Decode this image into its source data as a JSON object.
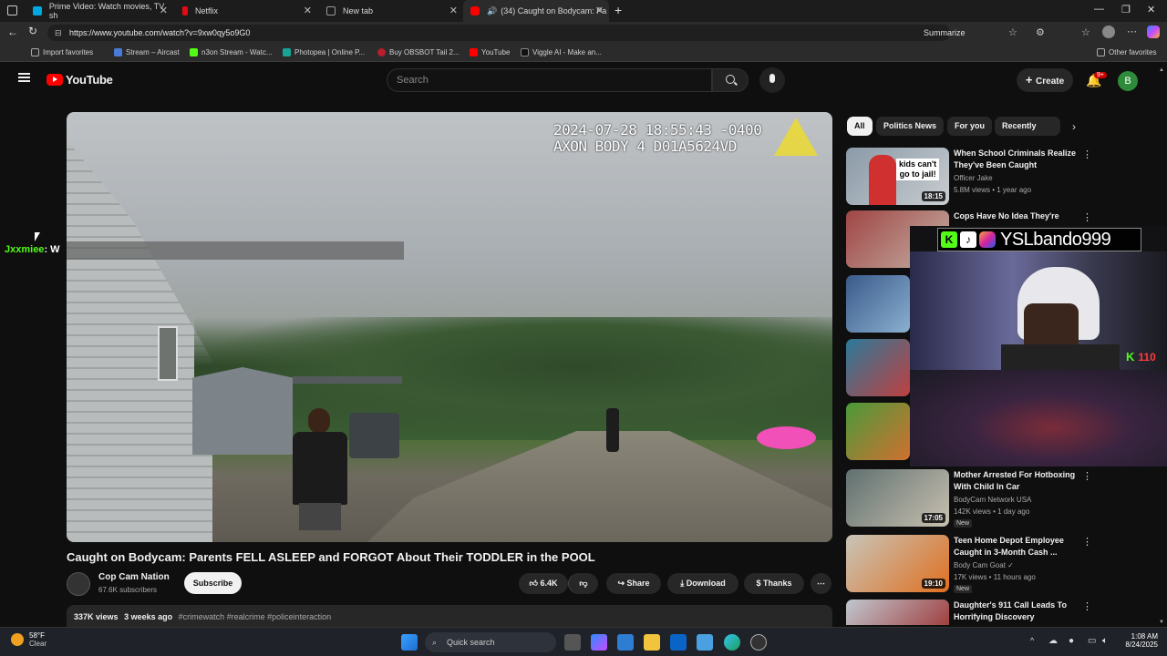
{
  "tabs": [
    {
      "label": "Prime Video: Watch movies, TV sh",
      "color": "#00a8e1"
    },
    {
      "label": "Netflix",
      "color": "#e50914"
    },
    {
      "label": "New tab",
      "color": "#888888"
    },
    {
      "label": "(34) Caught on Bodycam: Pa",
      "color": "#ff0000"
    }
  ],
  "address": {
    "url": "https://www.youtube.com/watch?v=9xw0qy5o9G0",
    "summarize": "Summarize"
  },
  "bookmarks": {
    "items": [
      "Import favorites",
      "Stream – Aircast",
      "n3on Stream - Watc...",
      "Photopea | Online P...",
      "Buy OBSBOT Tail 2...",
      "YouTube",
      "Viggle AI - Make an..."
    ],
    "other": "Other favorites"
  },
  "youtube": {
    "logo": "YouTube",
    "search_placeholder": "Search",
    "create": "Create",
    "notif_count": "9+",
    "avatar_letter": "B"
  },
  "video": {
    "timestamp": "2024-07-28 18:55:43 -0400",
    "device": "AXON BODY 4 D01A5624VD",
    "chat_user": "Jxxmiee",
    "chat_msg": ": W"
  },
  "watch": {
    "title": "Caught on Bodycam: Parents FELL ASLEEP and FORGOT About Their TODDLER in the POOL",
    "channel": "Cop Cam Nation",
    "subs": "67.6K subscribers",
    "subscribe": "Subscribe",
    "likes": "6.4K",
    "share": "Share",
    "download": "Download",
    "thanks": "Thanks",
    "views": "337K views",
    "age": "3 weeks ago",
    "hashtags": "#crimewatch #realcrime #policeinteraction"
  },
  "chips": [
    "All",
    "Politics News",
    "For you",
    "Recently uplo"
  ],
  "related": [
    {
      "title1": "When School Criminals Realize",
      "title2": "They've Been Caught",
      "channel": "Officer Jake",
      "meta": "5.8M views • 1 year ago",
      "duration": "18:15",
      "thumb_text1": "kids can't",
      "thumb_text2": "go to jail!",
      "new": ""
    },
    {
      "title1": "Cops Have No Idea They're",
      "title2": "",
      "channel": "",
      "meta": "",
      "duration": "",
      "new": ""
    },
    {
      "title1": "Mother Arrested For Hotboxing",
      "title2": "With Child In Car",
      "channel": "BodyCam Network USA",
      "meta": "142K views • 1 day ago",
      "duration": "17:05",
      "new": "New"
    },
    {
      "title1": "Teen Home Depot Employee",
      "title2": "Caught in 3-Month Cash ...",
      "channel": "Body Cam Goat",
      "meta": "17K views • 11 hours ago",
      "duration": "19:10",
      "new": "New"
    },
    {
      "title1": "Daughter's 911 Call Leads To",
      "title2": "Horrifying Discovery",
      "channel": "",
      "meta": "",
      "duration": "",
      "new": ""
    }
  ],
  "overlay": {
    "handle": "YSLbando999",
    "kick_count": "110"
  },
  "taskbar": {
    "temp": "58°F",
    "weather": "Clear",
    "search": "Quick search",
    "time": "1:08 AM",
    "date": "8/24/2025"
  }
}
